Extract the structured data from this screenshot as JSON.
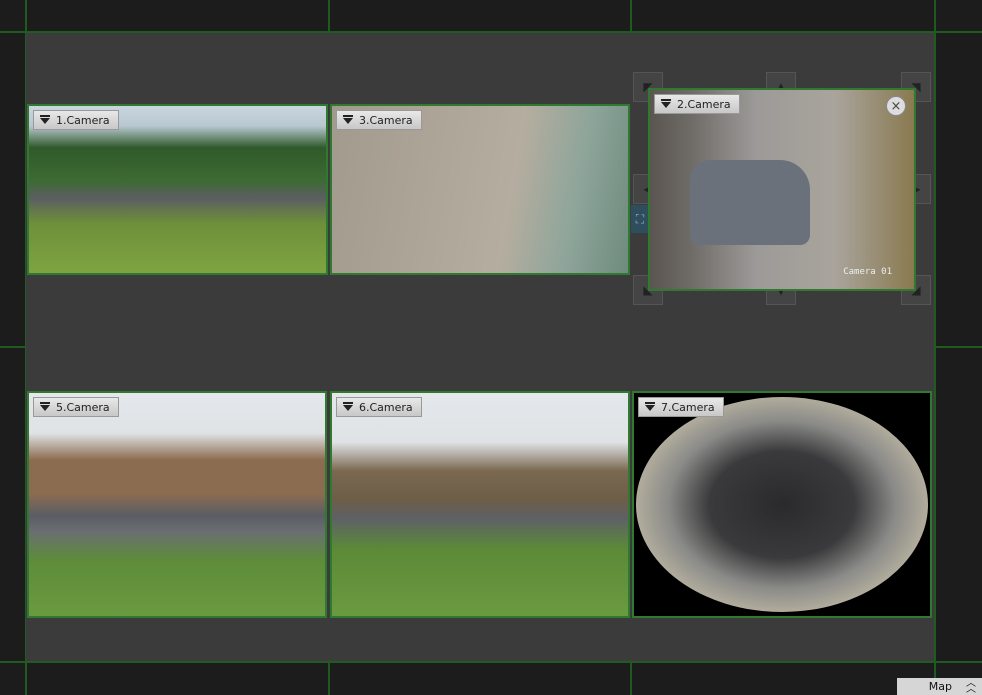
{
  "cameras": [
    {
      "label": "1.Camera"
    },
    {
      "label": "3.Camera"
    },
    {
      "label": "2.Camera",
      "osd": "Camera 01"
    },
    {
      "label": "5.Camera"
    },
    {
      "label": "6.Camera"
    },
    {
      "label": "7.Camera"
    }
  ],
  "icons": {
    "menu": "triangle-down",
    "close": "×",
    "link": "⛶",
    "map_toggle": "⌃⌃"
  },
  "map": {
    "label": "Map"
  },
  "colors": {
    "border": "#2f7a2f",
    "panel": "#3b3b3b"
  }
}
